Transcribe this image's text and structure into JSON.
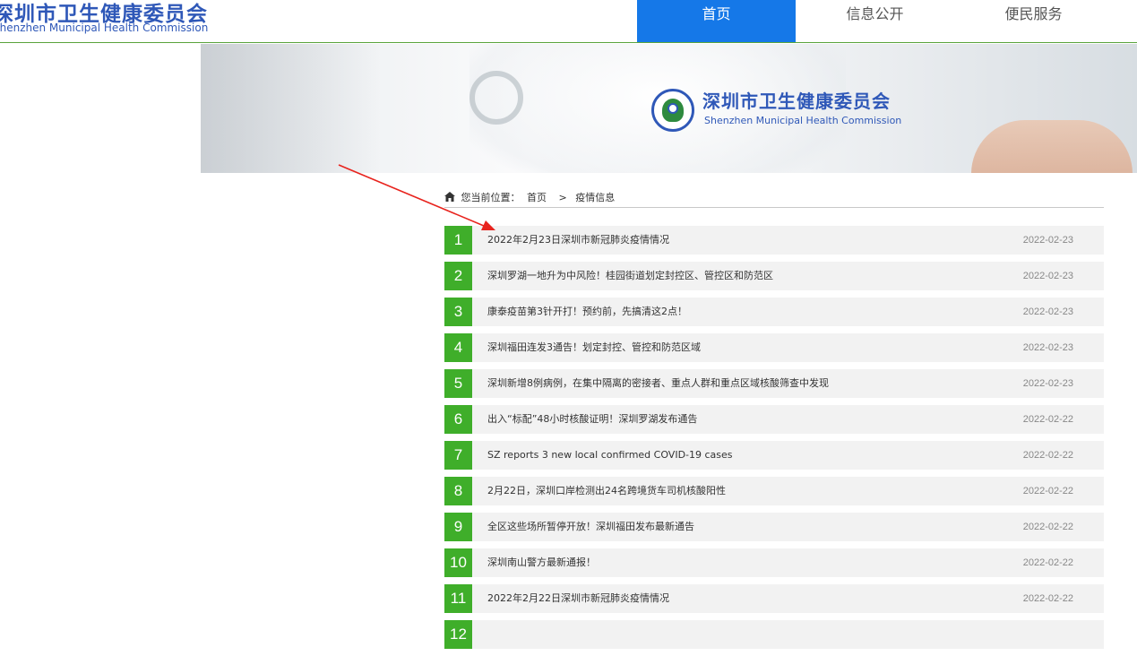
{
  "header": {
    "logo_cn": "深圳市卫生健康委员会",
    "logo_en": "Shenzhen Municipal Health Commission",
    "nav": [
      {
        "label": "首页",
        "active": true
      },
      {
        "label": "信息公开",
        "active": false
      },
      {
        "label": "便民服务",
        "active": false
      }
    ],
    "accent_color": "#1578e8",
    "border_color": "#5aa43d"
  },
  "banner": {
    "title_cn": "深圳市卫生健康委员会",
    "title_en": "Shenzhen Municipal Health Commission"
  },
  "breadcrumb": {
    "icon": "home-icon",
    "prefix": "您当前位置：",
    "items": [
      "首页",
      "疫情信息"
    ],
    "separator": ">"
  },
  "list": {
    "number_color": "#3fae2a",
    "items": [
      {
        "num": "1",
        "title": "2022年2月23日深圳市新冠肺炎疫情情况",
        "date": "2022-02-23"
      },
      {
        "num": "2",
        "title": "深圳罗湖一地升为中风险！桂园街道划定封控区、管控区和防范区",
        "date": "2022-02-23"
      },
      {
        "num": "3",
        "title": "康泰疫苗第3针开打！预约前，先搞清这2点！",
        "date": "2022-02-23"
      },
      {
        "num": "4",
        "title": "深圳福田连发3通告！划定封控、管控和防范区域",
        "date": "2022-02-23"
      },
      {
        "num": "5",
        "title": "深圳新增8例病例，在集中隔离的密接者、重点人群和重点区域核酸筛查中发现",
        "date": "2022-02-23"
      },
      {
        "num": "6",
        "title": "出入“标配”48小时核酸证明！深圳罗湖发布通告",
        "date": "2022-02-22"
      },
      {
        "num": "7",
        "title": "SZ reports 3 new local confirmed COVID-19 cases",
        "date": "2022-02-22"
      },
      {
        "num": "8",
        "title": "2月22日，深圳口岸检测出24名跨境货车司机核酸阳性",
        "date": "2022-02-22"
      },
      {
        "num": "9",
        "title": "全区这些场所暂停开放！深圳福田发布最新通告",
        "date": "2022-02-22"
      },
      {
        "num": "10",
        "title": "深圳南山警方最新通报！",
        "date": "2022-02-22"
      },
      {
        "num": "11",
        "title": "2022年2月22日深圳市新冠肺炎疫情情况",
        "date": "2022-02-22"
      },
      {
        "num": "12",
        "title": "",
        "date": ""
      }
    ]
  },
  "annotation": {
    "type": "arrow",
    "color": "#e8231d",
    "target": "list item 1"
  }
}
